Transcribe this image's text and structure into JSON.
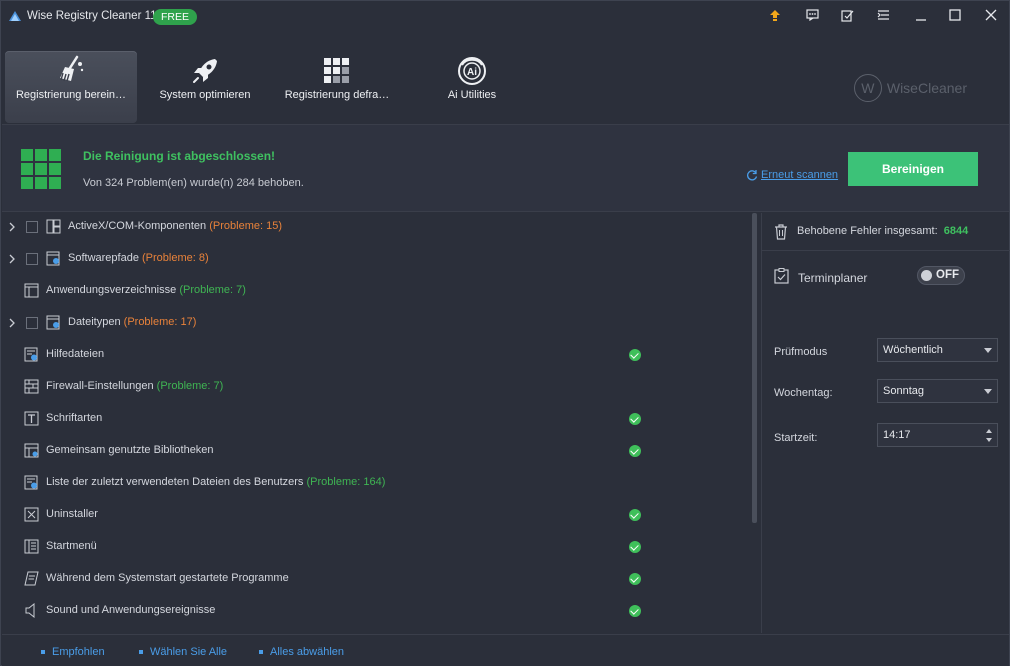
{
  "app": {
    "title": "Wise Registry Cleaner 11",
    "badge": "FREE",
    "brand": "WiseCleaner",
    "brand_mark": "W"
  },
  "toolbar": {
    "items": [
      {
        "label": "Registrierung berein…",
        "icon": "broom-icon",
        "active": true
      },
      {
        "label": "System optimieren",
        "icon": "rocket-icon"
      },
      {
        "label": "Registrierung defra…",
        "icon": "defrag-grid-icon"
      },
      {
        "label": "Ai Utilities",
        "icon": "ai-icon",
        "icon_text": "Ai"
      }
    ]
  },
  "status": {
    "title": "Die Reinigung ist abgeschlossen!",
    "subtitle": "Von 324 Problem(en) wurde(n) 284 behoben.",
    "rescan_label": "Erneut scannen",
    "clean_label": "Bereinigen"
  },
  "categories": [
    {
      "label": "ActiveX/COM-Komponenten",
      "problems": "(Probleme: 15)",
      "problem_color": "orange",
      "expandable": true,
      "checkbox": true,
      "ok": false
    },
    {
      "label": "Softwarepfade",
      "problems": "(Probleme: 8)",
      "problem_color": "orange",
      "expandable": true,
      "checkbox": true,
      "ok": false
    },
    {
      "label": "Anwendungsverzeichnisse",
      "problems": "(Probleme: 7)",
      "problem_color": "green",
      "expandable": false,
      "checkbox": false,
      "ok": false
    },
    {
      "label": "Dateitypen",
      "problems": "(Probleme: 17)",
      "problem_color": "orange",
      "expandable": true,
      "checkbox": true,
      "ok": false
    },
    {
      "label": "Hilfedateien",
      "problems": "",
      "problem_color": "",
      "expandable": false,
      "checkbox": false,
      "ok": true
    },
    {
      "label": "Firewall-Einstellungen",
      "problems": "(Probleme: 7)",
      "problem_color": "green",
      "expandable": false,
      "checkbox": false,
      "ok": false
    },
    {
      "label": "Schriftarten",
      "problems": "",
      "problem_color": "",
      "expandable": false,
      "checkbox": false,
      "ok": true
    },
    {
      "label": "Gemeinsam genutzte Bibliotheken",
      "problems": "",
      "problem_color": "",
      "expandable": false,
      "checkbox": false,
      "ok": true
    },
    {
      "label": "Liste der zuletzt verwendeten Dateien des Benutzers",
      "problems": "(Probleme: 164)",
      "problem_color": "green",
      "expandable": false,
      "checkbox": false,
      "ok": false
    },
    {
      "label": "Uninstaller",
      "problems": "",
      "problem_color": "",
      "expandable": false,
      "checkbox": false,
      "ok": true
    },
    {
      "label": "Startmenü",
      "problems": "",
      "problem_color": "",
      "expandable": false,
      "checkbox": false,
      "ok": true
    },
    {
      "label": "Während dem Systemstart gestartete Programme",
      "problems": "",
      "problem_color": "",
      "expandable": false,
      "checkbox": false,
      "ok": true
    },
    {
      "label": "Sound und Anwendungsereignisse",
      "problems": "",
      "problem_color": "",
      "expandable": false,
      "checkbox": false,
      "ok": true
    }
  ],
  "panel": {
    "fixed_label": "Behobene Fehler insgesamt:",
    "fixed_count": "6844",
    "scheduler_label": "Terminplaner",
    "scheduler_state": "OFF",
    "mode_label": "Prüfmodus",
    "mode_value": "Wöchentlich",
    "weekday_label": "Wochentag:",
    "weekday_value": "Sonntag",
    "start_label": "Startzeit:",
    "start_value": "14:17"
  },
  "footer": {
    "recommended": "Empfohlen",
    "select_all": "Wählen Sie Alle",
    "deselect_all": "Alles abwählen"
  },
  "colors": {
    "accent_green": "#3cc278",
    "problem_orange": "#e8823a",
    "problem_green": "#3fb553",
    "link_blue": "#4a9de8"
  }
}
